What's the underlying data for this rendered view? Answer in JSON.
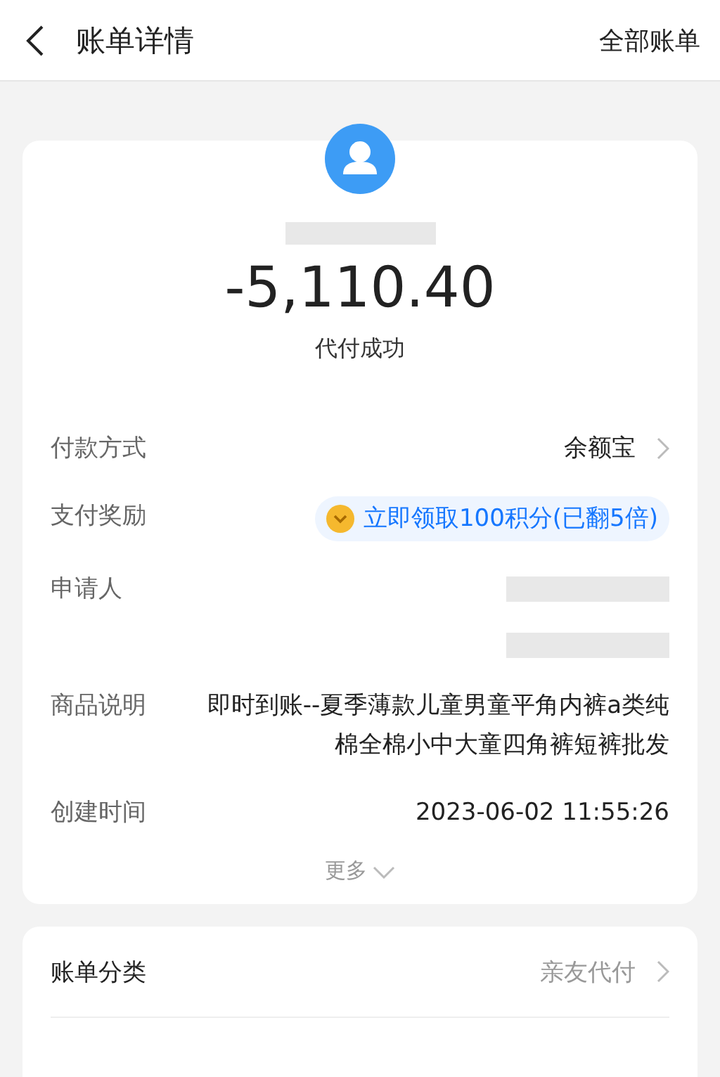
{
  "header": {
    "title": "账单详情",
    "action": "全部账单"
  },
  "summary": {
    "amount": "-5,110.40",
    "status": "代付成功"
  },
  "rows": [
    {
      "kind": "link",
      "label": "付款方式",
      "value": "余额宝"
    },
    {
      "kind": "reward",
      "label": "支付奖励",
      "value": "立即领取100积分(已翻5倍)"
    },
    {
      "kind": "redacted",
      "label": "申请人"
    },
    {
      "kind": "text",
      "label": "商品说明",
      "value": "即时到账--夏季薄款儿童男童平角内裤a类纯棉全棉小中大童四角裤短裤批发"
    },
    {
      "kind": "text",
      "label": "创建时间",
      "value": "2023-06-02 11:55:26"
    }
  ],
  "more": "更多",
  "category": {
    "label": "账单分类",
    "value": "亲友代付"
  }
}
